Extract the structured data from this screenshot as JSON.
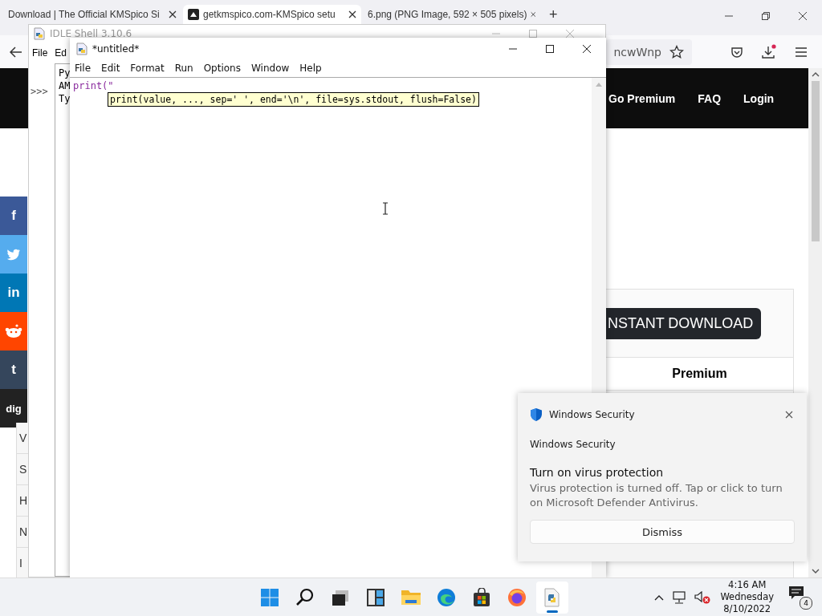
{
  "browser": {
    "tabs": [
      {
        "label": "Download | The Official KMSpico Si",
        "selected": false
      },
      {
        "label": "getkmspico.com-KMSpico setu",
        "selected": true
      },
      {
        "label": "6.png (PNG Image, 592 × 505 pixels)",
        "selected": false
      }
    ],
    "new_tab": "+",
    "address_fragment": "ncwWnp",
    "nav": [
      "Go Premium",
      "FAQ",
      "Login"
    ],
    "social": [
      {
        "kind": "facebook",
        "label": "f",
        "color": "#3b5998"
      },
      {
        "kind": "twitter",
        "color": "#55acee"
      },
      {
        "kind": "linkedin",
        "label": "in",
        "color": "#0077b5"
      },
      {
        "kind": "reddit",
        "color": "#ff4500"
      },
      {
        "kind": "tumblr",
        "label": "t",
        "color": "#35465c"
      },
      {
        "kind": "digg",
        "label": "dig",
        "color": "#222222"
      }
    ],
    "side_list": [
      "V",
      "S",
      "H",
      "N",
      "I"
    ],
    "download_button": "NSTANT DOWNLOAD",
    "plan": "Premium"
  },
  "shell": {
    "title": "IDLE Shell 3.10.6",
    "menu": [
      "File",
      "Ed"
    ],
    "lines": [
      "Py",
      "AM",
      "Ty"
    ],
    "prompt": ">>>"
  },
  "editor": {
    "title": "*untitled*",
    "menu": [
      "File",
      "Edit",
      "Format",
      "Run",
      "Options",
      "Window",
      "Help"
    ],
    "code": "print(\"",
    "calltip": "print(value, ..., sep=' ', end='\\n', file=sys.stdout, flush=False)"
  },
  "notification": {
    "app": "Windows Security",
    "source": "Windows Security",
    "heading": "Turn on virus protection",
    "body": "Virus protection is turned off. Tap or click to turn on Microsoft Defender Antivirus.",
    "button": "Dismiss"
  },
  "taskbar": {
    "apps": [
      {
        "kind": "start",
        "active": false
      },
      {
        "kind": "search",
        "active": false
      },
      {
        "kind": "taskview",
        "active": false
      },
      {
        "kind": "widgets",
        "active": false
      },
      {
        "kind": "explorer",
        "active": false
      },
      {
        "kind": "edge",
        "active": false
      },
      {
        "kind": "store",
        "active": false
      },
      {
        "kind": "firefox",
        "active": false
      },
      {
        "kind": "python",
        "active": true
      }
    ],
    "time": "4:16 AM",
    "day": "Wednesday",
    "date": "8/10/2022",
    "notifications": "4"
  }
}
